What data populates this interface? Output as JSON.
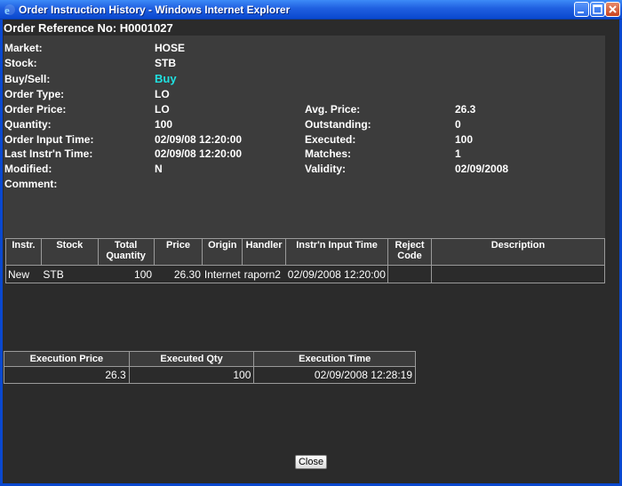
{
  "window": {
    "title": "Order Instruction History - Windows Internet Explorer"
  },
  "order_reference": "Order Reference No: H0001027",
  "details": {
    "market_label": "Market:",
    "market_value": "HOSE",
    "stock_label": "Stock:",
    "stock_value": "STB",
    "buysell_label": "Buy/Sell:",
    "buysell_value": "Buy",
    "ordertype_label": "Order Type:",
    "ordertype_value": "LO",
    "orderprice_label": "Order Price:",
    "orderprice_value": "LO",
    "quantity_label": "Quantity:",
    "quantity_value": "100",
    "inputtime_label": "Order Input Time:",
    "inputtime_value": "02/09/08 12:20:00",
    "lastinstr_label": "Last Instr'n Time:",
    "lastinstr_value": "02/09/08 12:20:00",
    "modified_label": "Modified:",
    "modified_value": "N",
    "comment_label": "Comment:",
    "avgprice_label": "Avg. Price:",
    "avgprice_value": "26.3",
    "outstanding_label": "Outstanding:",
    "outstanding_value": "0",
    "executed_label": "Executed:",
    "executed_value": "100",
    "matches_label": "Matches:",
    "matches_value": "1",
    "validity_label": "Validity:",
    "validity_value": "02/09/2008"
  },
  "instr_table": {
    "headers": {
      "instr": "Instr.",
      "stock": "Stock",
      "total_quantity_1": "Total",
      "total_quantity_2": "Quantity",
      "price": "Price",
      "origin": "Origin",
      "handler": "Handler",
      "input_time": "Instr'n Input Time",
      "reject_code_1": "Reject",
      "reject_code_2": "Code",
      "description": "Description"
    },
    "row": {
      "instr": "New",
      "stock": "STB",
      "total_quantity": "100",
      "price": "26.30",
      "origin": "Internet",
      "handler": "raporn2",
      "input_time": "02/09/2008 12:20:00",
      "reject_code": "",
      "description": ""
    }
  },
  "exec_table": {
    "headers": {
      "price": "Execution Price",
      "qty": "Executed Qty",
      "time": "Execution Time"
    },
    "row": {
      "price": "26.3",
      "qty": "100",
      "time": "02/09/2008 12:28:19"
    }
  },
  "close_button": "Close",
  "colors": {
    "background": "#2b2b2b",
    "panel": "#3c3c3c",
    "buy_highlight": "#20e0e0",
    "titlebar": "#0a48cf"
  }
}
